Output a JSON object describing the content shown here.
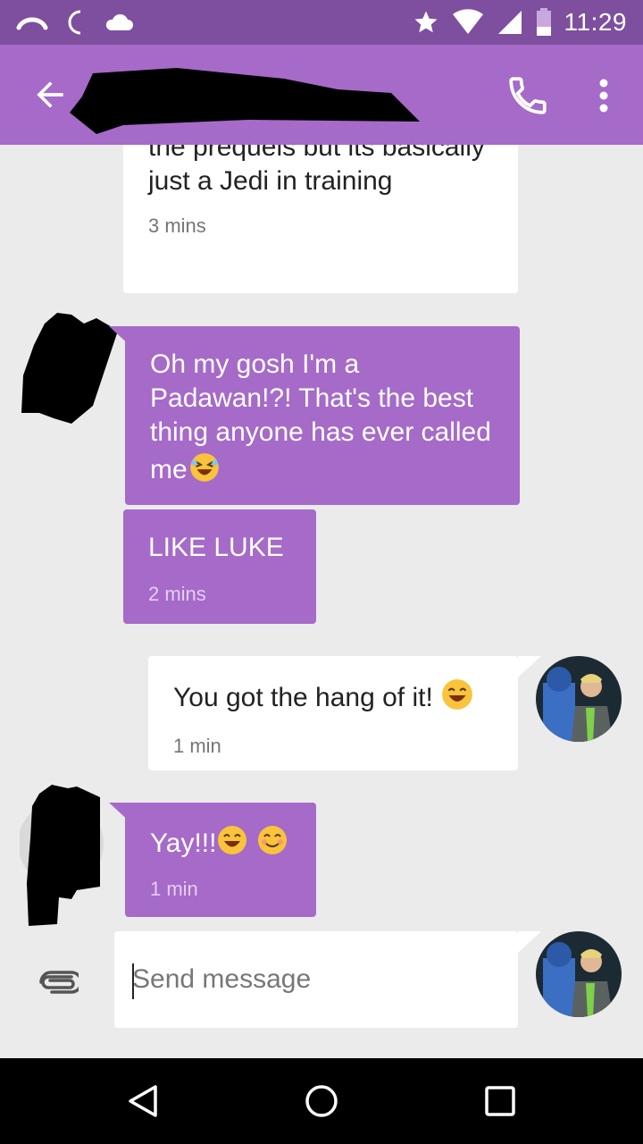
{
  "status_bar": {
    "time": "11:29",
    "icons": [
      "call-forward-icon",
      "moon-icon",
      "cloud-icon",
      "star-icon",
      "wifi-icon",
      "signal-icon",
      "battery-icon"
    ]
  },
  "app_bar": {
    "icons": [
      "back-arrow-icon",
      "phone-icon",
      "more-vert-icon"
    ]
  },
  "messages": [
    {
      "direction": "out",
      "text": "the prequels but its basically just a Jedi in training",
      "time": "3 mins"
    },
    {
      "direction": "in",
      "text": "Oh my gosh I'm a Padawan!?! That's the best thing anyone has ever called me",
      "emoji": "laughing-face-emoji"
    },
    {
      "direction": "in",
      "text": "LIKE LUKE",
      "time": "2 mins"
    },
    {
      "direction": "out",
      "text": "You got the hang of it!",
      "emoji": "grinning-face-emoji",
      "time": "1 min"
    },
    {
      "direction": "in",
      "text": "Yay!!!",
      "emojis": [
        "grinning-face-emoji",
        "smiling-face-emoji"
      ],
      "time": "1 min"
    }
  ],
  "composer": {
    "placeholder": "Send message",
    "attach_icon": "paperclip-icon"
  },
  "nav_bar": {
    "icons": [
      "back-triangle-icon",
      "home-circle-icon",
      "recents-square-icon"
    ]
  },
  "colors": {
    "status_bar": "#7e4f9e",
    "app_bar": "#a66ac9",
    "incoming_bubble": "#a66ac9",
    "outgoing_bubble": "#ffffff",
    "background": "#ebebeb"
  }
}
